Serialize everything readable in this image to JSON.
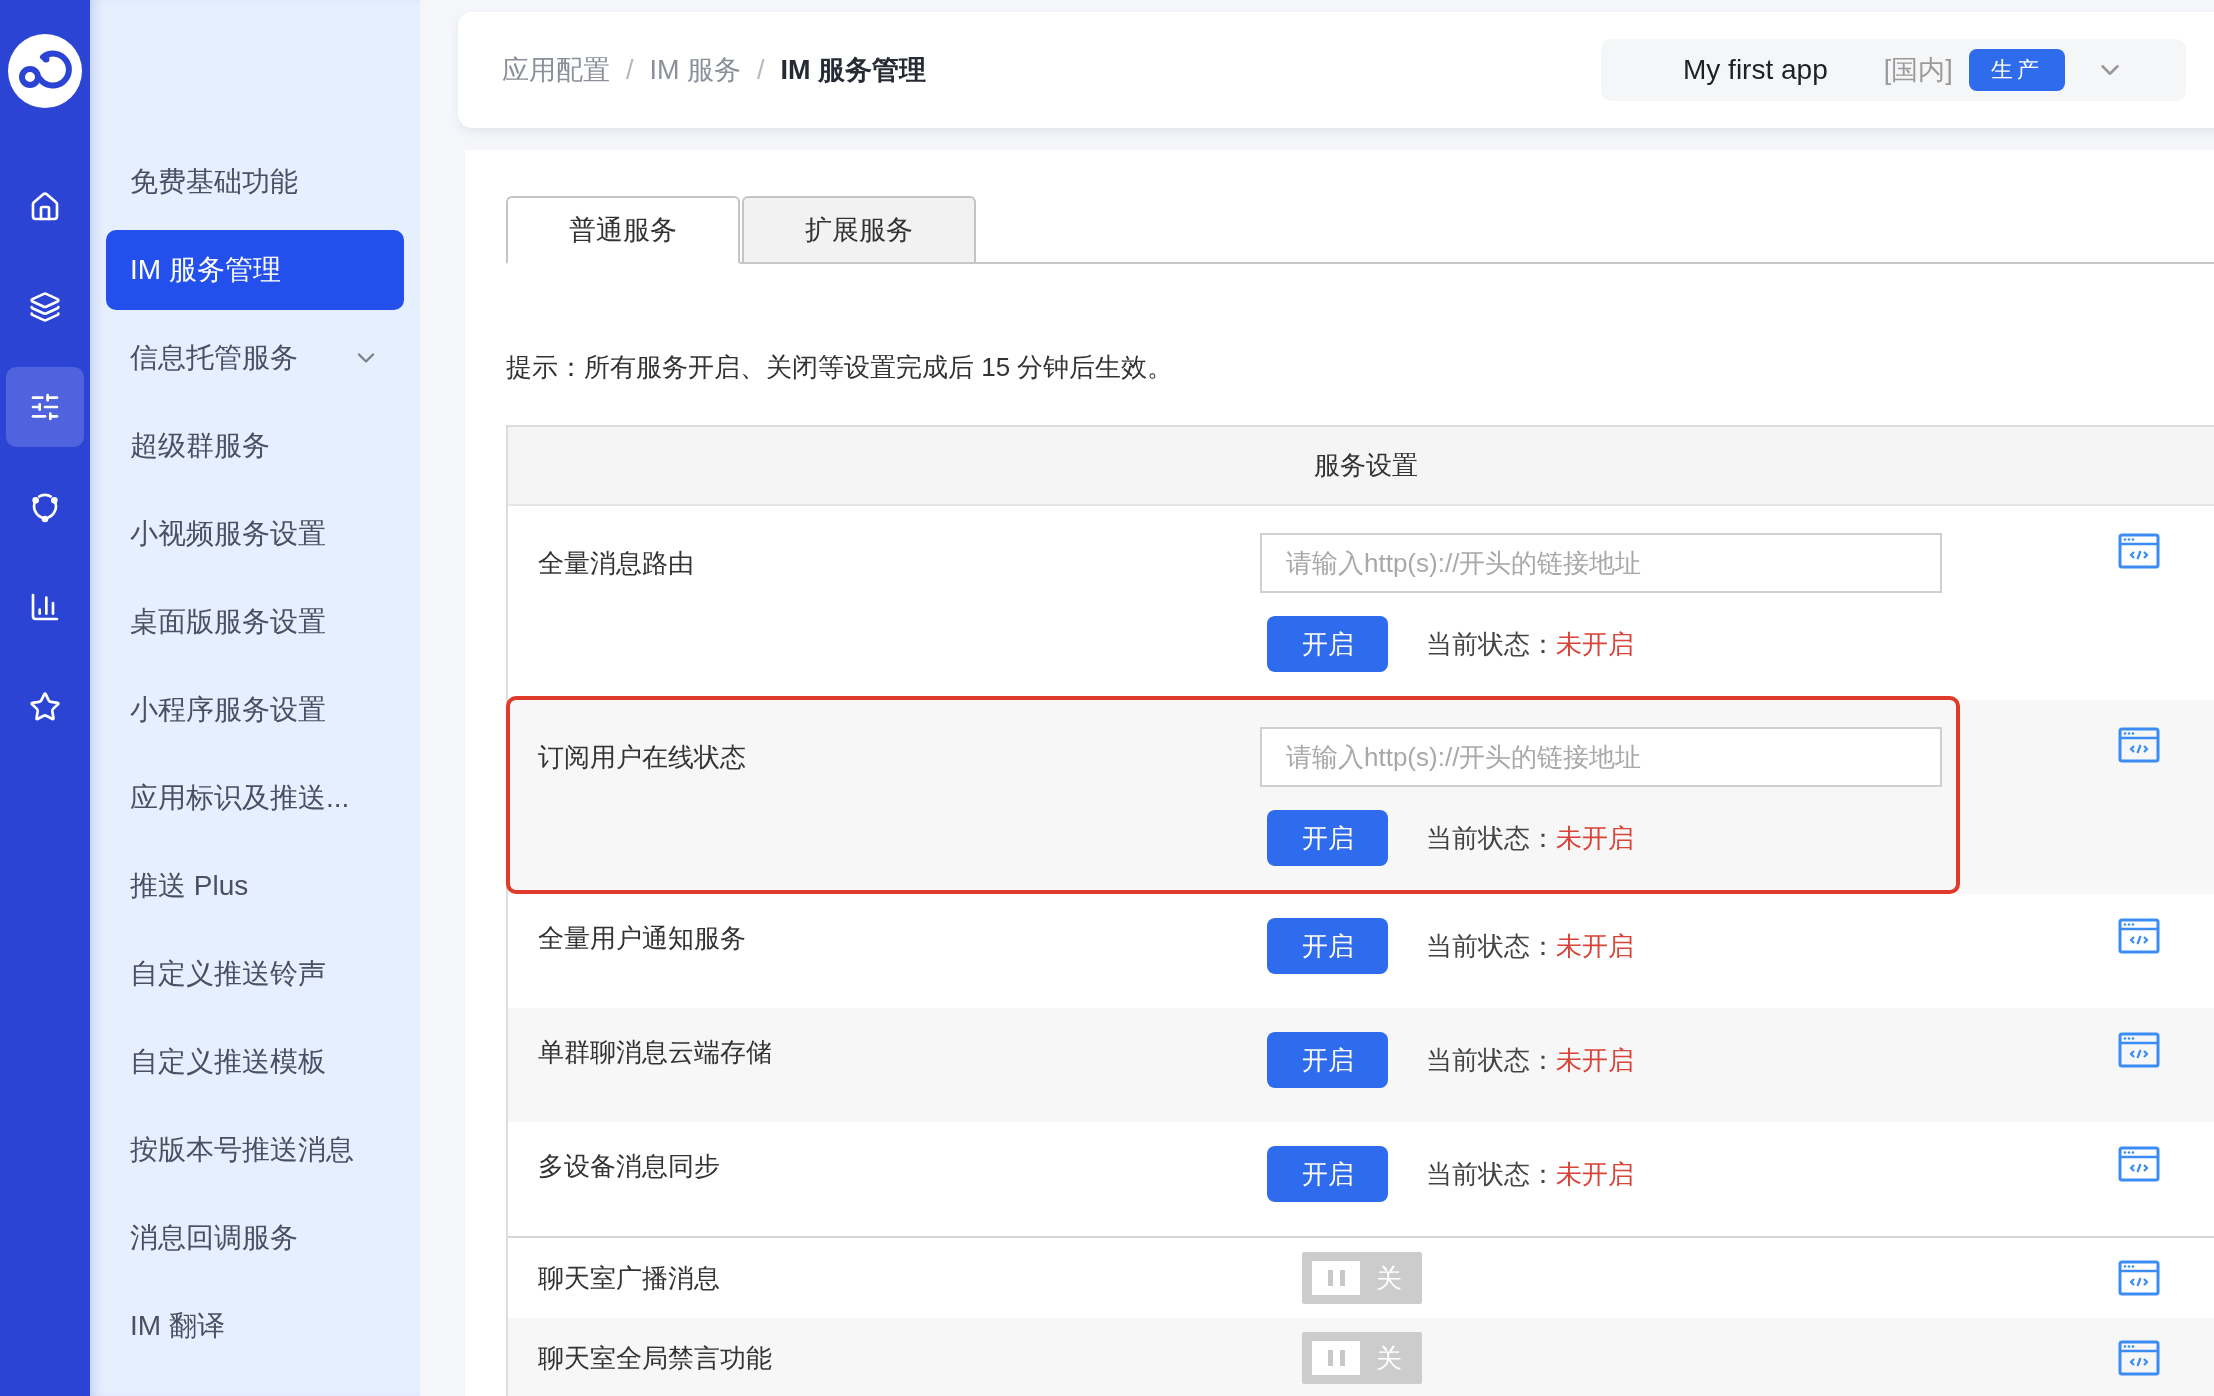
{
  "nav_rail": [
    {
      "selected": false
    },
    {
      "selected": false
    },
    {
      "selected": true
    },
    {
      "selected": false
    },
    {
      "selected": false
    },
    {
      "selected": false
    }
  ],
  "sidebar": {
    "items": [
      {
        "label": "免费基础功能",
        "selected": false,
        "has_submenu": false
      },
      {
        "label": "IM 服务管理",
        "selected": true,
        "has_submenu": false
      },
      {
        "label": "信息托管服务",
        "selected": false,
        "has_submenu": true
      },
      {
        "label": "超级群服务",
        "selected": false,
        "has_submenu": false
      },
      {
        "label": "小视频服务设置",
        "selected": false,
        "has_submenu": false
      },
      {
        "label": "桌面版服务设置",
        "selected": false,
        "has_submenu": false
      },
      {
        "label": "小程序服务设置",
        "selected": false,
        "has_submenu": false
      },
      {
        "label": "应用标识及推送...",
        "selected": false,
        "has_submenu": false
      },
      {
        "label": "推送 Plus",
        "selected": false,
        "has_submenu": false
      },
      {
        "label": "自定义推送铃声",
        "selected": false,
        "has_submenu": false
      },
      {
        "label": "自定义推送模板",
        "selected": false,
        "has_submenu": false
      },
      {
        "label": "按版本号推送消息",
        "selected": false,
        "has_submenu": false
      },
      {
        "label": "消息回调服务",
        "selected": false,
        "has_submenu": false
      },
      {
        "label": "IM 翻译",
        "selected": false,
        "has_submenu": false
      }
    ]
  },
  "header": {
    "breadcrumb": [
      {
        "label": "应用配置",
        "selected": false
      },
      {
        "label": "IM 服务",
        "selected": false
      },
      {
        "label": "IM 服务管理",
        "selected": true
      }
    ],
    "breadcrumb_separator": "/",
    "app_selector": {
      "name": "My first app",
      "region": "[国内]",
      "environment": "生产"
    }
  },
  "tabs": [
    {
      "label": "普通服务",
      "selected": true
    },
    {
      "label": "扩展服务",
      "selected": false
    }
  ],
  "hint": "提示：所有服务开启、关闭等设置完成后 15 分钟后生效。",
  "table": {
    "title": "服务设置",
    "sections": [
      {
        "rows": [
          {
            "kind": "url_switch",
            "label": "全量消息路由",
            "placeholder": "请输入http(s)://开头的链接地址",
            "button": "开启",
            "status_label": "当前状态：",
            "status": "未开启",
            "on": false,
            "highlighted": false
          },
          {
            "kind": "url_switch",
            "label": "订阅用户在线状态",
            "placeholder": "请输入http(s)://开头的链接地址",
            "button": "开启",
            "status_label": "当前状态：",
            "status": "未开启",
            "on": false,
            "highlighted": true
          },
          {
            "kind": "switch",
            "label": "全量用户通知服务",
            "button": "开启",
            "status_label": "当前状态：",
            "status": "未开启",
            "on": false,
            "highlighted": false
          },
          {
            "kind": "switch",
            "label": "单群聊消息云端存储",
            "button": "开启",
            "status_label": "当前状态：",
            "status": "未开启",
            "on": false,
            "highlighted": false
          },
          {
            "kind": "switch",
            "label": "多设备消息同步",
            "button": "开启",
            "status_label": "当前状态：",
            "status": "未开启",
            "on": false,
            "highlighted": false
          }
        ]
      },
      {
        "rows": [
          {
            "kind": "toggle",
            "label": "聊天室广播消息",
            "toggle_text": "关",
            "on": false,
            "highlighted": false
          },
          {
            "kind": "toggle",
            "label": "聊天室全局禁言功能",
            "toggle_text": "关",
            "on": false,
            "highlighted": false
          }
        ]
      }
    ]
  }
}
